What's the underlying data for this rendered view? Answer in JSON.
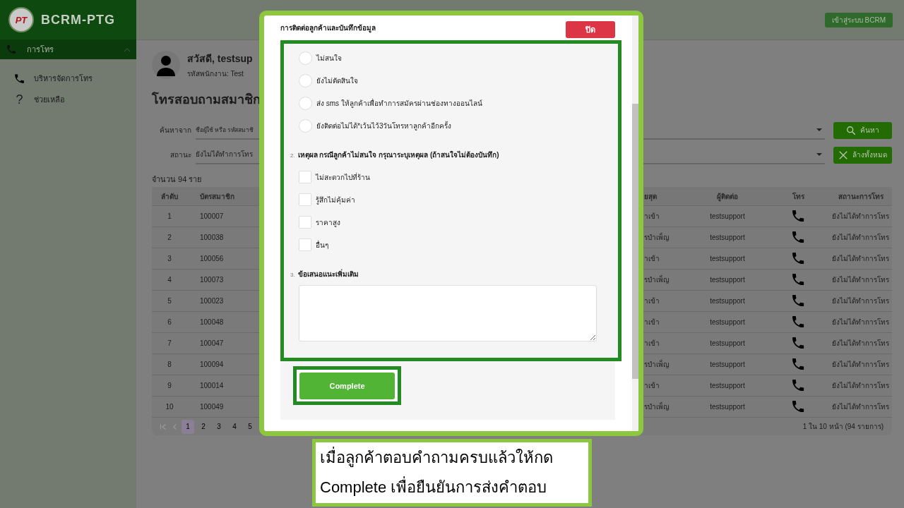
{
  "sidebar": {
    "logo_text": "PT",
    "brand": "BCRM-PTG",
    "group": {
      "label": "การโทร",
      "expanded": true
    },
    "items": [
      {
        "label": "บริหารจัดการโทร",
        "kind": "phone"
      },
      {
        "label": "ช่วยเหลือ",
        "kind": "glyph",
        "glyph": "?"
      }
    ]
  },
  "header": {
    "login_button": "เข้าสู่ระบบ BCRM"
  },
  "profile": {
    "greeting": "สวัสดี, testsup",
    "employee_id": "รหัสพนักงาน: Test"
  },
  "page_title": "โทรสอบถามสมาชิก",
  "filters": {
    "search_label": "ค้นหาจาก",
    "search_placeholder": "ชื่อผู้ใช้ หรือ รหัสสมาชิ",
    "search_button": "ค้นหา",
    "status_label": "สถานะ",
    "status_value": "ยังไม่ได้ทำการโทร",
    "clear_button": "ล้างทั้งหมด"
  },
  "count": "จำนวน 94 ราย",
  "table": {
    "columns": [
      "ลำดับ",
      "บัตรสมาชิก",
      "ยสุด",
      "ผู้ติดต่อ",
      "โทร",
      "สถานะการโทร"
    ],
    "rows": [
      [
        "1",
        "100007",
        "าเข้า",
        "testsupport",
        "ยังไม่ได้ทำการโทร"
      ],
      [
        "2",
        "100038",
        "รบำเพ็ญ",
        "testsupport",
        "ยังไม่ได้ทำการโทร"
      ],
      [
        "3",
        "100056",
        "าเข้า",
        "testsupport",
        "ยังไม่ได้ทำการโทร"
      ],
      [
        "4",
        "100073",
        "รบำเพ็ญ",
        "testsupport",
        "ยังไม่ได้ทำการโทร"
      ],
      [
        "5",
        "100023",
        "าเข้า",
        "testsupport",
        "ยังไม่ได้ทำการโทร"
      ],
      [
        "6",
        "100048",
        "าเข้า",
        "testsupport",
        "ยังไม่ได้ทำการโทร"
      ],
      [
        "7",
        "100047",
        "าเข้า",
        "testsupport",
        "ยังไม่ได้ทำการโทร"
      ],
      [
        "8",
        "100094",
        "รบำเพ็ญ",
        "testsupport",
        "ยังไม่ได้ทำการโทร"
      ],
      [
        "9",
        "100014",
        "าเข้า",
        "testsupport",
        "ยังไม่ได้ทำการโทร"
      ],
      [
        "10",
        "100049",
        "รบำเพ็ญ",
        "testsupport",
        "ยังไม่ได้ทำการโทร"
      ]
    ],
    "pages": [
      {
        "label": "1",
        "selected": true
      },
      {
        "label": "2",
        "selected": false
      },
      {
        "label": "3",
        "selected": false
      },
      {
        "label": "4",
        "selected": false
      },
      {
        "label": "5",
        "selected": false
      }
    ],
    "page_info": "1 ใน 10 หน้า (94 รายการ)"
  },
  "modal": {
    "title": "การติดต่อลูกค้าและบันทึกข้อมูล",
    "close_button": "ปิด",
    "options": [
      {
        "label": "ไม่สนใจ",
        "selected": false
      },
      {
        "label": "ยังไม่ตัดสินใจ",
        "selected": false
      },
      {
        "label": "ส่ง sms ให้ลูกค้าเพื่อทำการสมัครผ่านช่องทางออนไลน์",
        "selected": false
      },
      {
        "label": "ยังติดต่อไม่ได้*เว้นไว้3วันโทรหาลูกค้าอีกครั้ง",
        "selected": false
      }
    ],
    "question_2": {
      "number": "2.",
      "text": "เหตุผล กรณีลูกค้าไม่สนใจ กรุณาระบุเหตุผล (ถ้าสนใจไม่ต้องบันทึก)"
    },
    "reasons": [
      {
        "label": "ไม่สะดวกไปที่ร้าน",
        "checked": false
      },
      {
        "label": "รู้สึกไม่คุ้มค่า",
        "checked": false
      },
      {
        "label": "ราคาสูง",
        "checked": false
      },
      {
        "label": "อื่นๆ",
        "checked": false
      }
    ],
    "question_3": {
      "number": "3.",
      "text": "ข้อเสนอแนะเพิ่มเติม"
    },
    "complete_button": "Complete"
  },
  "callout": "เมื่อลูกค้าตอบคำถามครบแล้วให้กด\nComplete เพื่อยืนยันการส่งคำตอบ"
}
